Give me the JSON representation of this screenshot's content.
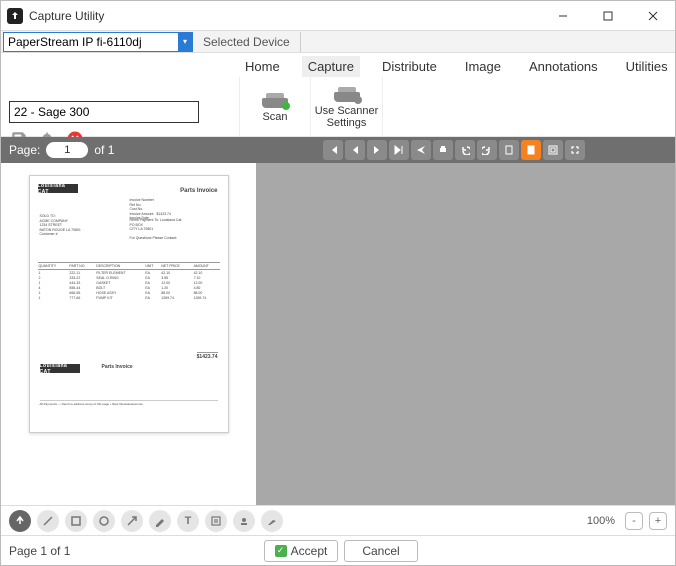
{
  "titlebar": {
    "title": "Capture Utility"
  },
  "device": {
    "selected": "PaperStream IP fi-6110dj",
    "label": "Selected Device"
  },
  "tabs": {
    "home": "Home",
    "capture": "Capture",
    "distribute": "Distribute",
    "image": "Image",
    "annotations": "Annotations",
    "utilities": "Utilities"
  },
  "ribbon": {
    "scan": "Scan",
    "use_settings_l1": "Use Scanner",
    "use_settings_l2": "Settings"
  },
  "job": {
    "name": "22 - Sage 300"
  },
  "pager": {
    "label_page": "Page:",
    "current": "1",
    "of": "of",
    "total": "1"
  },
  "zoom": {
    "pct": "100%"
  },
  "footer": {
    "status": "Page 1 of 1",
    "accept": "Accept",
    "cancel": "Cancel"
  },
  "doc": {
    "logo": "Louisiana CAT",
    "title": "Parts Invoice",
    "meta": "Invoice Number\nRef No.\nCust No.\nInvoice Amount   $1423.74\nInvoice Date",
    "addr": "SOLD TO:\nACME COMPANY\n1234 STREET\nBATON ROUGE LA 70801\nCustomer #",
    "addr2": "Remit Payment To: Louisiana Cat\nPO BOX\nCITY LA 70801\n\nFor Questions Please Contact:",
    "total": "$1423.74",
    "footnote": "All Payments — Remit to address at top of this page • https://louisianacat.com"
  }
}
